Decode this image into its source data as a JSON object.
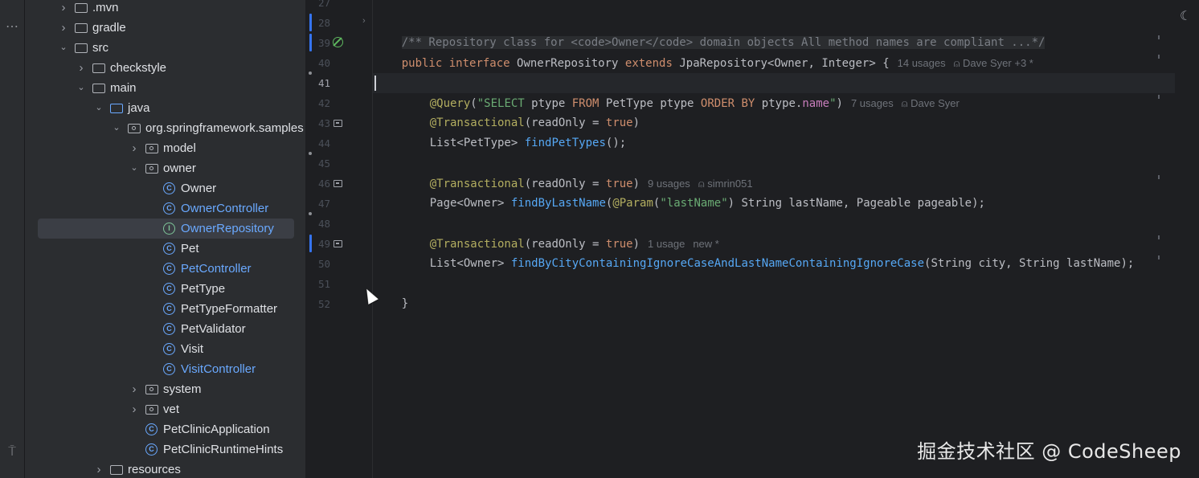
{
  "tree": {
    "items": [
      {
        "label": ".mvn",
        "depth": 1,
        "expanded": false,
        "icon": "folder-icon"
      },
      {
        "label": "gradle",
        "depth": 1,
        "expanded": false,
        "icon": "folder-icon"
      },
      {
        "label": "src",
        "depth": 1,
        "expanded": true,
        "icon": "folder-icon"
      },
      {
        "label": "checkstyle",
        "depth": 2,
        "expanded": false,
        "icon": "folder-icon"
      },
      {
        "label": "main",
        "depth": 2,
        "expanded": true,
        "icon": "folder-icon"
      },
      {
        "label": "java",
        "depth": 3,
        "expanded": true,
        "icon": "source-folder-icon"
      },
      {
        "label": "org.springframework.samples",
        "depth": 4,
        "expanded": true,
        "icon": "package-icon"
      },
      {
        "label": "model",
        "depth": 5,
        "expanded": false,
        "icon": "package-icon"
      },
      {
        "label": "owner",
        "depth": 5,
        "expanded": true,
        "icon": "package-icon"
      },
      {
        "label": "Owner",
        "depth": 6,
        "icon": "class-icon"
      },
      {
        "label": "OwnerController",
        "depth": 6,
        "icon": "class-icon",
        "modified": true
      },
      {
        "label": "OwnerRepository",
        "depth": 6,
        "icon": "interface-icon",
        "modified": true,
        "selected": true
      },
      {
        "label": "Pet",
        "depth": 6,
        "icon": "class-icon"
      },
      {
        "label": "PetController",
        "depth": 6,
        "icon": "class-icon",
        "modified": true
      },
      {
        "label": "PetType",
        "depth": 6,
        "icon": "class-icon"
      },
      {
        "label": "PetTypeFormatter",
        "depth": 6,
        "icon": "class-icon"
      },
      {
        "label": "PetValidator",
        "depth": 6,
        "icon": "class-icon"
      },
      {
        "label": "Visit",
        "depth": 6,
        "icon": "class-icon"
      },
      {
        "label": "VisitController",
        "depth": 6,
        "icon": "class-icon",
        "modified": true
      },
      {
        "label": "system",
        "depth": 5,
        "expanded": false,
        "icon": "package-icon"
      },
      {
        "label": "vet",
        "depth": 5,
        "expanded": false,
        "icon": "package-icon"
      },
      {
        "label": "PetClinicApplication",
        "depth": 5,
        "icon": "spring-class-icon"
      },
      {
        "label": "PetClinicRuntimeHints",
        "depth": 5,
        "icon": "class-icon"
      },
      {
        "label": "resources",
        "depth": 3,
        "expanded": false,
        "icon": "resources-folder-icon"
      }
    ]
  },
  "gutter": {
    "lines": [
      "27",
      "28",
      "39",
      "40",
      "41",
      "42",
      "43",
      "44",
      "45",
      "46",
      "47",
      "48",
      "49",
      "50",
      "51",
      "52"
    ],
    "current": "41"
  },
  "editor": {
    "l28": "/** Repository class for <code>Owner</code> domain objects All method names are compliant ...*/",
    "l39_kw1": "public",
    "l39_kw2": "interface",
    "l39_name": " OwnerRepository ",
    "l39_kw3": "extends",
    "l39_rest": " JpaRepository<Owner, Integer> {",
    "l39_hint1": "14 usages",
    "l39_hint2": "Dave Syer +3 *",
    "l41_ann": "@Query",
    "l41_p1": "(",
    "l41_s1": "\"SELECT ",
    "l41_s2": "ptype ",
    "l41_k1": "FROM ",
    "l41_s3": "PetType ptype ",
    "l41_k2": "ORDER BY ",
    "l41_s4": "ptype.",
    "l41_fld": "name",
    "l41_s5": "\"",
    "l41_p2": ")",
    "l41_hint1": "7 usages",
    "l41_hint2": "Dave Syer",
    "l42_ann": "@Transactional",
    "l42_p1": "(readOnly = ",
    "l42_kw": "true",
    "l42_p2": ")",
    "l43_type": "List<PetType> ",
    "l43_fn": "findPetTypes",
    "l43_rest": "();",
    "l45_ann": "@Transactional",
    "l45_p1": "(readOnly = ",
    "l45_kw": "true",
    "l45_p2": ")",
    "l45_hint1": "9 usages",
    "l45_hint2": "simrin051",
    "l46_type": "Page<Owner> ",
    "l46_fn": "findByLastName",
    "l46_p1": "(",
    "l46_ann": "@Param",
    "l46_p2": "(",
    "l46_str": "\"lastName\"",
    "l46_rest": ") String lastName, Pageable pageable);",
    "l48_ann": "@Transactional",
    "l48_p1": "(readOnly = ",
    "l48_kw": "true",
    "l48_p2": ")",
    "l48_hint1": "1 usage",
    "l48_hint2": "new *",
    "l49_type": "List<Owner> ",
    "l49_fn": "findByCityContainingIgnoreCaseAndLastNameContainingIgnoreCase",
    "l49_rest": "(String city, String lastName);",
    "l51": "}"
  },
  "icons": {
    "top_menu": "⋯",
    "bottom_tool": "⍑",
    "right_ai": "☾"
  },
  "watermark": "掘金技术社区 @ CodeSheep",
  "colors": {
    "keyword": "#cf8e6d",
    "annotation": "#b3ae60",
    "string": "#6aab73",
    "method": "#56a8f5",
    "field": "#c77dbb",
    "comment": "#7a7e85",
    "modified_file": "#6aa9ff"
  }
}
